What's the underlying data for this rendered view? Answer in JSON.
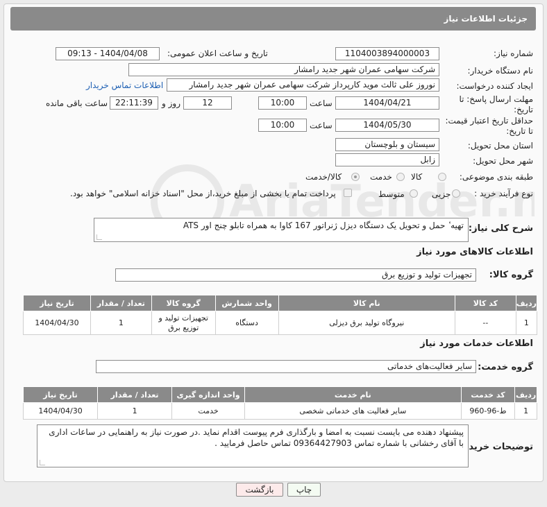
{
  "header": {
    "title": "جزئیات اطلاعات نیاز"
  },
  "fields": {
    "need_number_label": "شماره نیاز:",
    "need_number": "1104003894000003",
    "announce_label": "تاریخ و ساعت اعلان عمومی:",
    "announce_value": "1404/04/08 - 09:13",
    "buyer_label": "نام دستگاه خریدار:",
    "buyer_value": "شرکت سهامی عمران شهر جدید رامشار",
    "creator_label": "ایجاد کننده درخواست:",
    "creator_value": "نوروز علی  ثالث موید کارپرداز شرکت سهامی عمران شهر جدید رامشار",
    "contact_link": "اطلاعات تماس خریدار",
    "deadline_label": "مهلت ارسال پاسخ: تا تاریخ:",
    "deadline_date": "1404/04/21",
    "deadline_time_label": "ساعت",
    "deadline_time": "10:00",
    "days_value": "12",
    "days_label": "روز و",
    "remaining_value": "22:11:39",
    "remaining_label": "ساعت باقی مانده",
    "validity_label": "حداقل تاریخ اعتبار قیمت: تا تاریخ:",
    "validity_date": "1404/05/30",
    "validity_time_label": "ساعت",
    "validity_time": "10:00",
    "province_label": "استان محل تحویل:",
    "province_value": "سیستان و بلوچستان",
    "city_label": "شهر محل تحویل:",
    "city_value": "زابل",
    "category_label": "طبقه بندی موضوعی:",
    "category_options": [
      "کالا",
      "خدمت",
      "کالا/خدمت"
    ],
    "process_label": "نوع فرآیند خرید :",
    "process_options": [
      "جزیی",
      "متوسط"
    ],
    "process_note": "پرداخت تمام یا بخشی از مبلغ خرید،از محل \"اسناد خزانه اسلامی\" خواهد بود."
  },
  "description": {
    "label": "شرح کلی نیاز:",
    "value": "تهیه ٔ حمل و تحویل یک دستگاه دیزل ژنراتور 167 کاوا به همراه تابلو چنج اور ATS"
  },
  "goods": {
    "section_title": "اطلاعات کالاهای مورد نیاز",
    "group_label": "گروه کالا:",
    "group_value": "تجهیزات تولید و توزیع برق",
    "headers": [
      "ردیف",
      "کد کالا",
      "نام کالا",
      "واحد شمارش",
      "گروه کالا",
      "تعداد / مقدار",
      "تاریخ نیاز"
    ],
    "rows": [
      [
        "1",
        "--",
        "نیروگاه تولید برق دیزلی",
        "دستگاه",
        "تجهیزات تولید و توزیع برق",
        "1",
        "1404/04/30"
      ]
    ]
  },
  "services": {
    "section_title": "اطلاعات خدمات مورد نیاز",
    "group_label": "گروه خدمت:",
    "group_value": "سایر فعالیت‌های خدماتی",
    "headers": [
      "ردیف",
      "کد خدمت",
      "نام خدمت",
      "واحد اندازه گیری",
      "تعداد / مقدار",
      "تاریخ نیاز"
    ],
    "rows": [
      [
        "1",
        "ط-96-960",
        "سایر فعالیت های خدماتی شخصی",
        "خدمت",
        "1",
        "1404/04/30"
      ]
    ]
  },
  "buyer_notes": {
    "label": "توضیحات خریدار:",
    "value": "پیشنهاد دهنده می بایست نسبت به امضا و بارگذاری فرم پیوست اقدام نماید .در صورت نیاز به راهنمایی در ساعات اداری با آقای رخشانی با شماره تماس 09364427903 تماس حاصل فرمایید ."
  },
  "buttons": {
    "print": "چاپ",
    "back": "بازگشت"
  },
  "watermark": "AriaTender.neT"
}
